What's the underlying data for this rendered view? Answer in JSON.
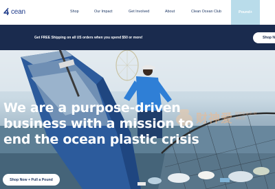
{
  "header": {
    "logo_text": "cean",
    "nav": [
      {
        "label": "Shop"
      },
      {
        "label": "Our Impact"
      },
      {
        "label": "Get Involved"
      },
      {
        "label": "About"
      },
      {
        "label": "Clean Ocean Club"
      }
    ],
    "cta_label": "Pound+"
  },
  "announcement": {
    "text": "Get FREE Shipping on all US orders when you spend $50 or more!",
    "button_label": "Shop N"
  },
  "hero": {
    "title_lines": [
      "We are a purpose-driven",
      "business with a mission to",
      "end the ocean plastic crisis"
    ],
    "button_label": "Shop Now + Pull a Pound"
  },
  "watermark": {
    "text": "财神爱",
    "subtext": "财神爱资讯·财神资讯"
  },
  "colors": {
    "brand_navy": "#1a2b4e",
    "nav_text": "#16315f",
    "cta_bg": "#b9dcea",
    "logo_blue": "#1d3a8a"
  }
}
